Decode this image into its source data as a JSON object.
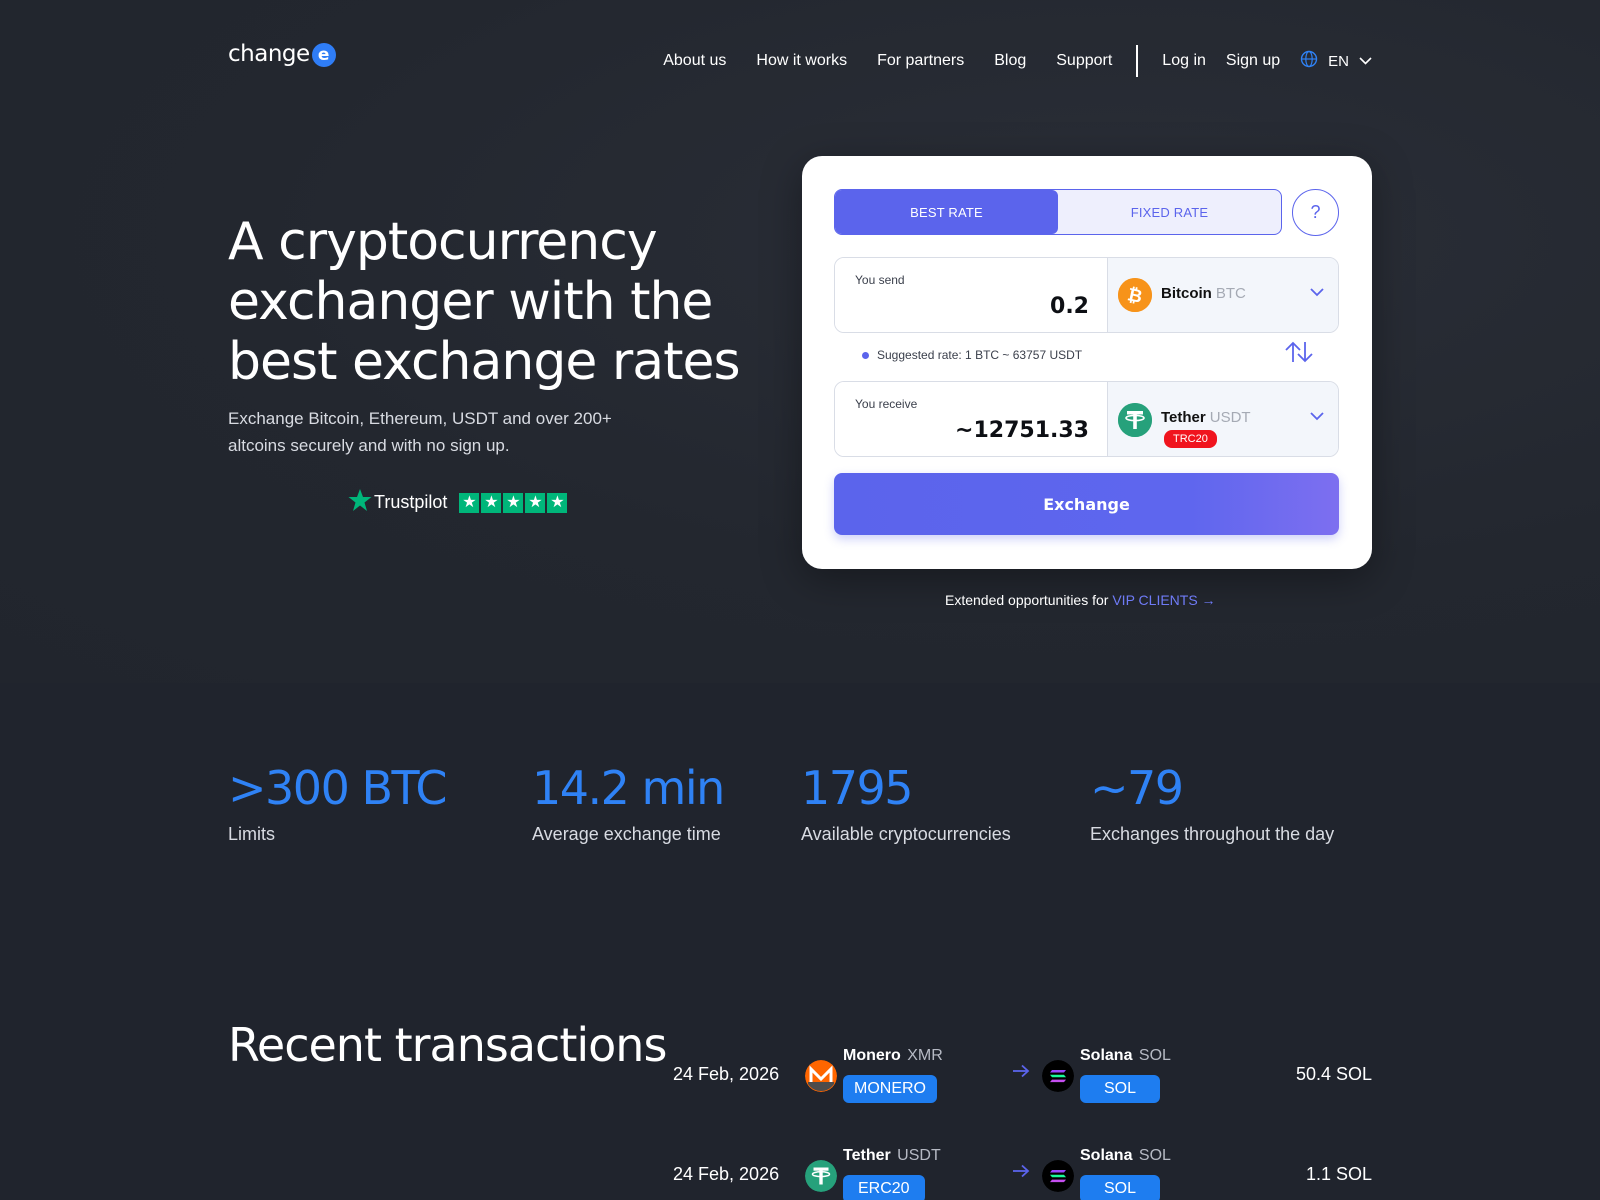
{
  "brand": {
    "logo_text": "change",
    "logo_badge": "e"
  },
  "nav": {
    "links": [
      "About us",
      "How it works",
      "For partners",
      "Blog",
      "Support"
    ],
    "login": "Log in",
    "signup": "Sign up",
    "language": "EN"
  },
  "hero": {
    "title": "A cryptocurrency exchanger with the best exchange rates",
    "subtitle": "Exchange Bitcoin, Ethereum, USDT and over 200+ altcoins securely and with no sign up.",
    "trustpilot": "Trustpilot"
  },
  "exchange": {
    "best_rate": "BEST RATE",
    "fixed_rate": "FIXED RATE",
    "help": "?",
    "send_label": "You send",
    "send_value": "0.2",
    "send_coin": "Bitcoin",
    "send_ticker": "BTC",
    "suggested_rate": "Suggested rate: 1 BTC ~ 63757 USDT",
    "receive_label": "You receive",
    "receive_value": "~12751.33",
    "receive_coin": "Tether",
    "receive_ticker": "USDT",
    "receive_network": "TRC20",
    "button": "Exchange"
  },
  "vip": {
    "text": "Extended opportunities for ",
    "link": "VIP CLIENTS →"
  },
  "stats": [
    {
      "value": ">300 BTC",
      "label": "Limits"
    },
    {
      "value": "14.2 min",
      "label": "Average exchange time"
    },
    {
      "value": "1795",
      "label": "Available cryptocurrencies"
    },
    {
      "value": "~79",
      "label": "Exchanges throughout the day"
    }
  ],
  "recent": {
    "title": "Recent transactions",
    "rows": [
      {
        "date": "24 Feb, 2026",
        "from_name": "Monero",
        "from_ticker": "XMR",
        "from_tag": "MONERO",
        "to_name": "Solana",
        "to_ticker": "SOL",
        "to_tag": "SOL",
        "amount": "50.4 SOL"
      },
      {
        "date": "24 Feb, 2026",
        "from_name": "Tether",
        "from_ticker": "USDT",
        "from_tag": "ERC20",
        "to_name": "Solana",
        "to_ticker": "SOL",
        "to_tag": "SOL",
        "amount": "1.1 SOL"
      }
    ]
  },
  "colors": {
    "accent": "#5b64ec",
    "stat_blue": "#2f82f5",
    "tag_blue": "#1e7df0",
    "background": "#20242d",
    "trc20_red": "#f0141e"
  },
  "icons": [
    "globe-icon",
    "chevron-down-icon",
    "bitcoin-icon",
    "tether-icon",
    "swap-icon",
    "monero-icon",
    "solana-icon",
    "arrow-right-icon",
    "trustpilot-star-icon"
  ]
}
